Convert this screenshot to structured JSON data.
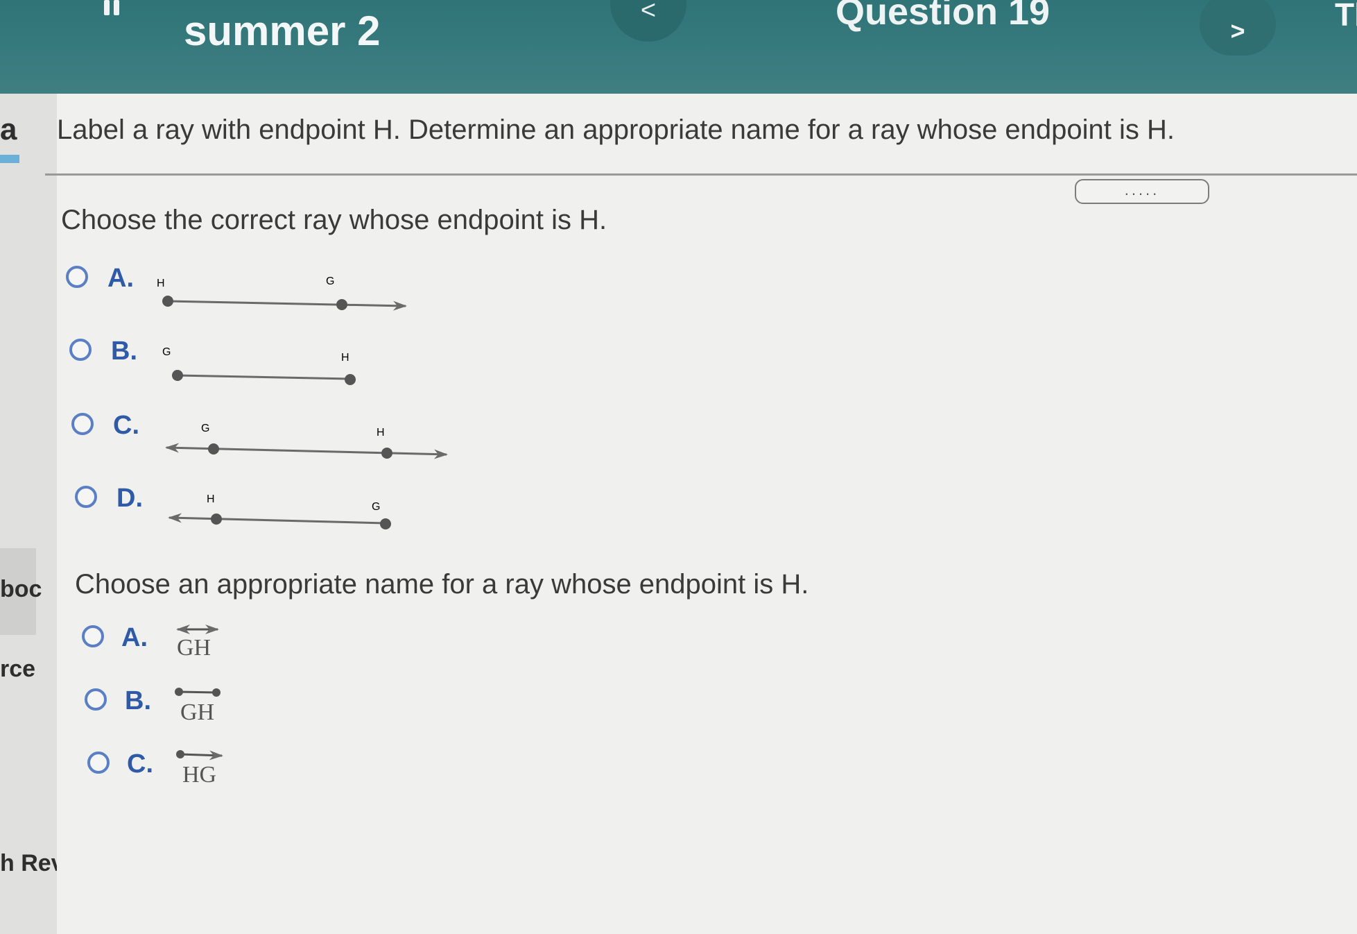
{
  "header": {
    "title": "summer 2",
    "question_label": "Question 19",
    "prev_label": "<",
    "next_label": ">",
    "edge_label": "Tl"
  },
  "sidebar": {
    "mark": "a",
    "fragments": [
      "boc",
      "rce",
      "h Rev"
    ]
  },
  "question": {
    "instruction": "Label a ray with endpoint H. Determine an appropriate name for a ray whose endpoint is H.",
    "more_label": ".....",
    "part1": {
      "prompt": "Choose the correct ray whose endpoint is H.",
      "options": [
        {
          "letter": "A.",
          "left_point": "H",
          "right_point": "G"
        },
        {
          "letter": "B.",
          "left_point": "G",
          "right_point": "H"
        },
        {
          "letter": "C.",
          "left_point": "G",
          "right_point": "H"
        },
        {
          "letter": "D.",
          "left_point": "H",
          "right_point": "G"
        }
      ]
    },
    "part2": {
      "prompt": "Choose an appropriate name for a ray whose endpoint is H.",
      "options": [
        {
          "letter": "A.",
          "name": "GH",
          "symbol": "line"
        },
        {
          "letter": "B.",
          "name": "GH",
          "symbol": "segment"
        },
        {
          "letter": "C.",
          "name": "HG",
          "symbol": "ray"
        }
      ]
    }
  },
  "colors": {
    "header": "#3a7b7e",
    "radio": "#5b7fc4",
    "option_letter": "#2e5aa8"
  }
}
